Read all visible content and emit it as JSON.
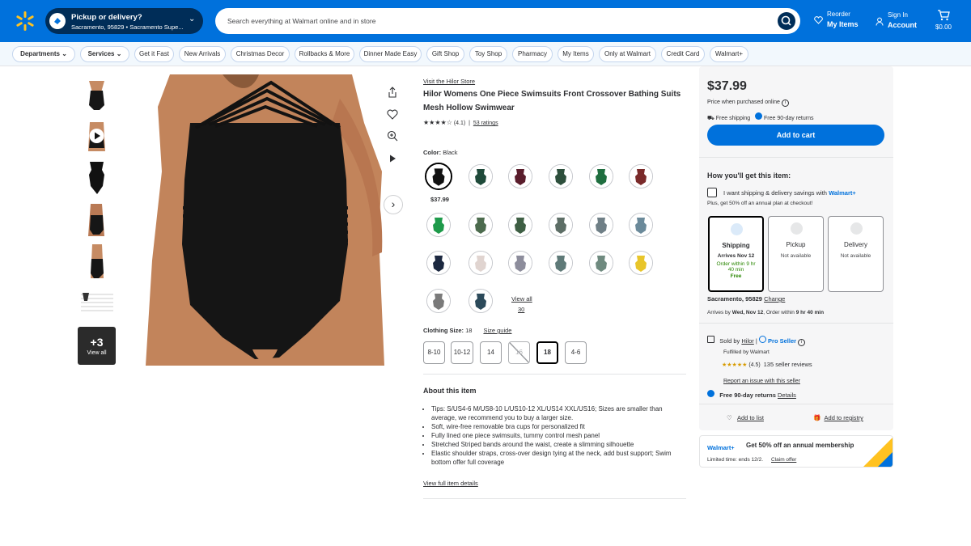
{
  "header": {
    "pickup_title": "Pickup or delivery?",
    "pickup_location": "Sacramento, 95829 • Sacramento Supe...",
    "search_placeholder": "Search everything at Walmart online and in store",
    "reorder_top": "Reorder",
    "reorder_bottom": "My Items",
    "signin_top": "Sign In",
    "signin_bottom": "Account",
    "cart_total": "$0.00"
  },
  "nav": [
    "Departments",
    "Services",
    "Get it Fast",
    "New Arrivals",
    "Christmas Decor",
    "Rollbacks & More",
    "Dinner Made Easy",
    "Gift Shop",
    "Toy Shop",
    "Pharmacy",
    "My Items",
    "Only at Walmart",
    "Credit Card",
    "Walmart+"
  ],
  "gallery": {
    "more_count": "+3",
    "more_label": "View all"
  },
  "product": {
    "store_link": "Visit the Hilor Store",
    "title": "Hilor Womens One Piece Swimsuits Front Crossover Bathing Suits Mesh Hollow Swimwear",
    "rating": "(4.1)",
    "rating_value": 4.1,
    "ratings_link": "53 ratings",
    "separator": "|",
    "color_label": "Color:",
    "color_value": "Black",
    "selected_price": "$37.99",
    "view_all": "View all",
    "view_all_count": "30",
    "size_label": "Clothing Size:",
    "size_value": "18",
    "size_guide": "Size guide",
    "sizes": [
      "8-10",
      "10-12",
      "14",
      "16",
      "18",
      "4-6"
    ],
    "about_title": "About this item",
    "about_bullets": [
      "Tips: S/US4-6 M/US8-10 L/US10-12 XL/US14 XXL/US16; Sizes are smaller than average, we recommend you to buy a larger size.",
      "Soft, wire-free removable bra cups for personalized fit",
      "Fully lined one piece swimsuits, tummy control mesh panel",
      "Stretched Striped bands around the waist, create a slimming silhouette",
      "Elastic shoulder straps, cross-over design tying at the neck, add bust support; Swim bottom offer full coverage"
    ],
    "full_details": "View full item details"
  },
  "swatch_colors": [
    "#111111",
    "#1f4a3a",
    "#5a1d2c",
    "#2d4f3c",
    "#1f6e3f",
    "#7a2a2a",
    "#1e9a4a",
    "#4c6b4e",
    "#3e5f44",
    "#5d6e66",
    "#6f7f86",
    "#6b8a9a",
    "#1c2840",
    "#e0d4d0",
    "#8d8d9c",
    "#5f7a78",
    "#6f8a7f",
    "#e8c52a",
    "#7a7a7a",
    "#2c4a5a"
  ],
  "buy": {
    "price": "$37.99",
    "price_note": "Price when purchased online",
    "free_shipping": "Free shipping",
    "free_returns": "Free 90-day returns",
    "add_to_cart": "Add to cart",
    "how_title": "How you'll get this item:",
    "savings_text": "I want shipping & delivery savings with",
    "walmart_plus": "Walmart+",
    "plus_note": "Plus, get 50% off an annual plan at checkout!",
    "ship_title": "Shipping",
    "ship_arrives": "Arrives Nov 12",
    "ship_order": "Order within 9 hr 40 min",
    "ship_free": "Free",
    "pickup_title": "Pickup",
    "pickup_status": "Not available",
    "delivery_title": "Delivery",
    "delivery_status": "Not available",
    "location": "Sacramento, 95829",
    "change": "Change",
    "arrives_prefix": "Arrives by",
    "arrives_date": "Wed, Nov 12",
    "order_within_prefix": "Order within",
    "order_within": "9 hr 40 min",
    "sold_by": "Sold by",
    "seller": "Hilor",
    "pro_seller": "Pro Seller",
    "fulfilled": "Fulfilled by Walmart",
    "seller_rating": "(4.5)",
    "seller_rating_value": 4.5,
    "seller_reviews": "135 seller reviews",
    "report": "Report an issue with this seller",
    "returns": "Free 90-day returns",
    "details": "Details",
    "add_list": "Add to list",
    "add_registry": "Add to registry"
  },
  "promo": {
    "brand": "Walmart+",
    "headline": "Get 50% off an annual membership",
    "limited": "Limited time: ends 12/2.",
    "claim": "Claim offer"
  },
  "colors": {
    "walmart_blue": "#0071dc",
    "navy": "#002d58",
    "yellow": "#ffc220",
    "green": "#2a8703"
  }
}
